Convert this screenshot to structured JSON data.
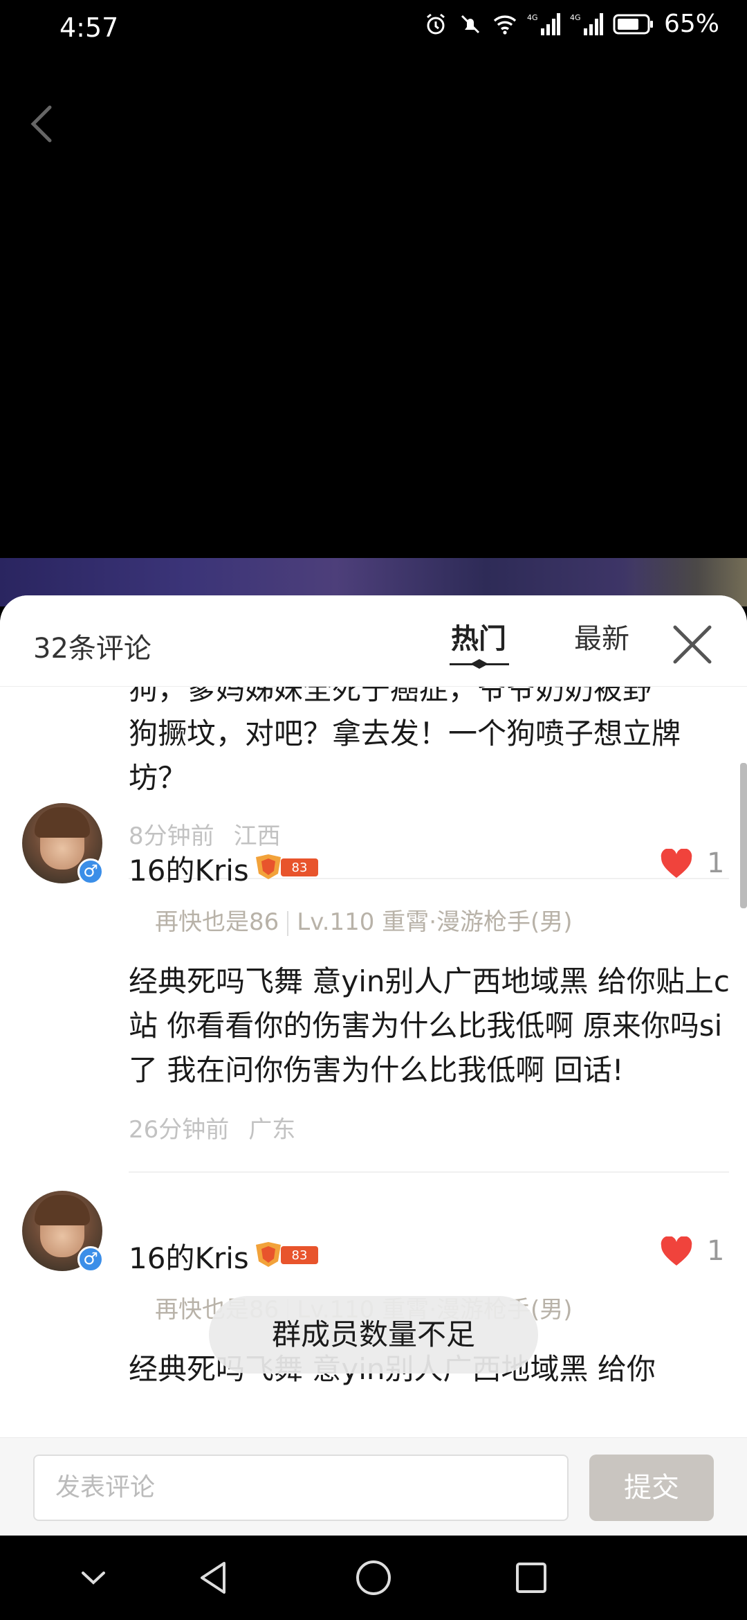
{
  "status_bar": {
    "time": "4:57",
    "battery_percent": "65%",
    "icons": [
      "alarm-icon",
      "mute-icon",
      "wifi-icon",
      "signal-4g-icon",
      "signal-4g-icon",
      "battery-icon"
    ],
    "network_label_1": "4G",
    "network_label_2": "4G"
  },
  "video": {
    "back_icon": "chevron-left-icon"
  },
  "sheet": {
    "comment_count": "32条评论",
    "tabs": [
      {
        "label": "热门",
        "active": true
      },
      {
        "label": "最新",
        "active": false
      }
    ],
    "close_icon": "close-icon"
  },
  "comments": [
    {
      "partial": true,
      "text_line_0": "狗，爹妈姊妹全死于癌症，爷爷奶奶被野",
      "text": "狗撅坟，对吧？拿去发！一个狗喷子想立牌坊？",
      "time": "8分钟前",
      "location": "江西"
    },
    {
      "username": "16的Kris",
      "badge_number": "83",
      "likes": "1",
      "game_info_nickname": "再快也是86",
      "game_info_detail": "Lv.110 重霄·漫游枪手(男)",
      "text": "经典死吗飞舞 意yin别人广西地域黑 给你贴上c站 你看看你的伤害为什么比我低啊 原来你吗si了 我在问你伤害为什么比我低啊 回话!",
      "time": "26分钟前",
      "location": "广东"
    },
    {
      "username": "16的Kris",
      "badge_number": "83",
      "likes": "1",
      "game_info_nickname": "再快也是86",
      "game_info_detail": "Lv.110 重霄·漫游枪手(男)",
      "text": "经典死吗飞舞 意yin别人广西地域黑 给你"
    }
  ],
  "toast": "群成员数量不足",
  "input": {
    "placeholder": "发表评论",
    "submit_label": "提交"
  },
  "nav_bar": {
    "icons": [
      "chevron-down-icon",
      "back-triangle-icon",
      "home-circle-icon",
      "recents-square-icon"
    ]
  },
  "colors": {
    "like_red": "#f0433c",
    "gender_blue": "#3b8ee8",
    "badge_orange": "#e8542c",
    "submit_disabled": "#c9c5c0"
  }
}
